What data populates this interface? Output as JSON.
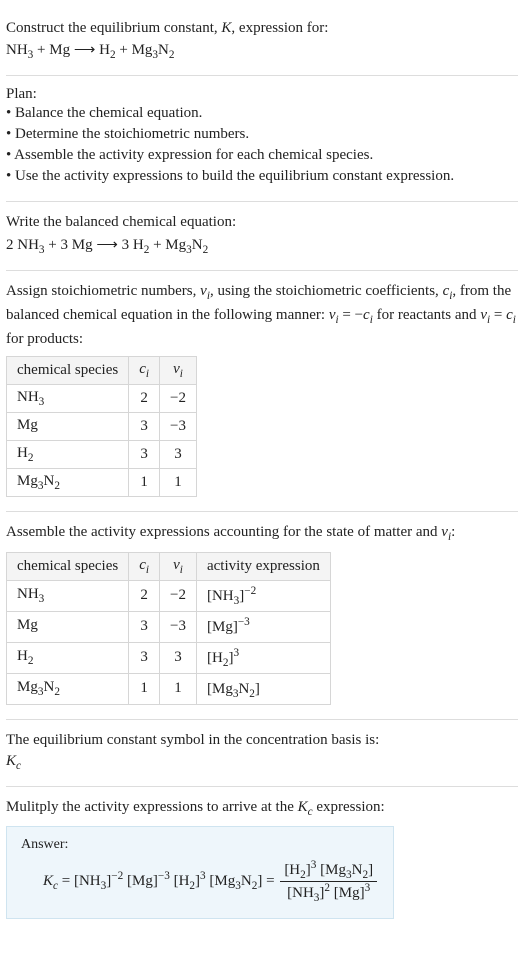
{
  "prompt": {
    "line1_pre": "Construct the equilibrium constant, ",
    "line1_K": "K",
    "line1_post": ", expression for:",
    "eq_lhs_a": "NH",
    "eq_lhs_a_sub": "3",
    "eq_plus": " + ",
    "eq_lhs_b": "Mg",
    "eq_arrow": " ⟶ ",
    "eq_rhs_a": "H",
    "eq_rhs_a_sub": "2",
    "eq_rhs_b": "Mg",
    "eq_rhs_b_sub1": "3",
    "eq_rhs_b_mid": "N",
    "eq_rhs_b_sub2": "2"
  },
  "plan": {
    "title": "Plan:",
    "b1": "• Balance the chemical equation.",
    "b2": "• Determine the stoichiometric numbers.",
    "b3": "• Assemble the activity expression for each chemical species.",
    "b4": "• Use the activity expressions to build the equilibrium constant expression."
  },
  "balanced": {
    "intro": "Write the balanced chemical equation:",
    "c1": "2 NH",
    "c1s": "3",
    "c2": " + 3 Mg ⟶ 3 H",
    "c2s": "2",
    "c3": " + Mg",
    "c3s1": "3",
    "c3m": "N",
    "c3s2": "2"
  },
  "assign": {
    "p_a": "Assign stoichiometric numbers, ",
    "nu": "ν",
    "sub_i": "i",
    "p_b": ", using the stoichiometric coefficients, ",
    "c": "c",
    "p_c": ", from the balanced chemical equation in the following manner: ",
    "rel1_pre": "ν",
    "rel1_mid": " = −",
    "rel1_c": "c",
    "p_d": " for reactants and ",
    "rel2_pre": "ν",
    "rel2_mid": " = ",
    "rel2_c": "c",
    "p_e": " for products:",
    "th_species": "chemical species",
    "th_ci": "c",
    "th_nu": "ν",
    "rows": [
      {
        "sp_a": "NH",
        "sp_s1": "3",
        "sp_b": "",
        "sp_s2": "",
        "ci": "2",
        "nu": "−2"
      },
      {
        "sp_a": "Mg",
        "sp_s1": "",
        "sp_b": "",
        "sp_s2": "",
        "ci": "3",
        "nu": "−3"
      },
      {
        "sp_a": "H",
        "sp_s1": "2",
        "sp_b": "",
        "sp_s2": "",
        "ci": "3",
        "nu": "3"
      },
      {
        "sp_a": "Mg",
        "sp_s1": "3",
        "sp_b": "N",
        "sp_s2": "2",
        "ci": "1",
        "nu": "1"
      }
    ]
  },
  "activity": {
    "intro_a": "Assemble the activity expressions accounting for the state of matter and ",
    "nu": "ν",
    "sub_i": "i",
    "intro_b": ":",
    "th_species": "chemical species",
    "th_ci": "c",
    "th_nu": "ν",
    "th_act": "activity expression",
    "rows": [
      {
        "sp_a": "NH",
        "sp_s1": "3",
        "sp_b": "",
        "sp_s2": "",
        "ci": "2",
        "nu": "−2",
        "ax_a": "[NH",
        "ax_s1": "3",
        "ax_b": "]",
        "ax_exp": "−2",
        "ax_c": "",
        "ax_s2": "",
        "ax_d": ""
      },
      {
        "sp_a": "Mg",
        "sp_s1": "",
        "sp_b": "",
        "sp_s2": "",
        "ci": "3",
        "nu": "−3",
        "ax_a": "[Mg]",
        "ax_s1": "",
        "ax_b": "",
        "ax_exp": "−3",
        "ax_c": "",
        "ax_s2": "",
        "ax_d": ""
      },
      {
        "sp_a": "H",
        "sp_s1": "2",
        "sp_b": "",
        "sp_s2": "",
        "ci": "3",
        "nu": "3",
        "ax_a": "[H",
        "ax_s1": "2",
        "ax_b": "]",
        "ax_exp": "3",
        "ax_c": "",
        "ax_s2": "",
        "ax_d": ""
      },
      {
        "sp_a": "Mg",
        "sp_s1": "3",
        "sp_b": "N",
        "sp_s2": "2",
        "ci": "1",
        "nu": "1",
        "ax_a": "[Mg",
        "ax_s1": "3",
        "ax_b": "N",
        "ax_exp": "",
        "ax_c": "",
        "ax_s2": "2",
        "ax_d": "]"
      }
    ]
  },
  "symbol": {
    "line": "The equilibrium constant symbol in the concentration basis is:",
    "K": "K",
    "Ksub": "c"
  },
  "mult": {
    "line_a": "Mulitply the activity expressions to arrive at the ",
    "K": "K",
    "Ksub": "c",
    "line_b": " expression:"
  },
  "answer": {
    "label": "Answer:",
    "K": "K",
    "Ksub": "c",
    "eq": " = ",
    "t1_a": "[NH",
    "t1_s": "3",
    "t1_b": "]",
    "t1_e": "−2",
    "t2_a": " [Mg]",
    "t2_e": "−3",
    "t3_a": " [H",
    "t3_s": "2",
    "t3_b": "]",
    "t3_e": "3",
    "t4_a": " [Mg",
    "t4_s1": "3",
    "t4_m": "N",
    "t4_s2": "2",
    "t4_b": "]",
    "eq2": " = ",
    "num_a": "[H",
    "num_s": "2",
    "num_b": "]",
    "num_e": "3",
    "num2_a": " [Mg",
    "num2_s1": "3",
    "num2_m": "N",
    "num2_s2": "2",
    "num2_b": "]",
    "den_a": "[NH",
    "den_s": "3",
    "den_b": "]",
    "den_e": "2",
    "den2_a": " [Mg]",
    "den2_e": "3"
  },
  "chart_data": {
    "type": "table",
    "tables": [
      {
        "title": "stoichiometric numbers",
        "columns": [
          "chemical species",
          "c_i",
          "ν_i"
        ],
        "rows": [
          [
            "NH3",
            2,
            -2
          ],
          [
            "Mg",
            3,
            -3
          ],
          [
            "H2",
            3,
            3
          ],
          [
            "Mg3N2",
            1,
            1
          ]
        ]
      },
      {
        "title": "activity expressions",
        "columns": [
          "chemical species",
          "c_i",
          "ν_i",
          "activity expression"
        ],
        "rows": [
          [
            "NH3",
            2,
            -2,
            "[NH3]^-2"
          ],
          [
            "Mg",
            3,
            -3,
            "[Mg]^-3"
          ],
          [
            "H2",
            3,
            3,
            "[H2]^3"
          ],
          [
            "Mg3N2",
            1,
            1,
            "[Mg3N2]"
          ]
        ]
      }
    ]
  }
}
